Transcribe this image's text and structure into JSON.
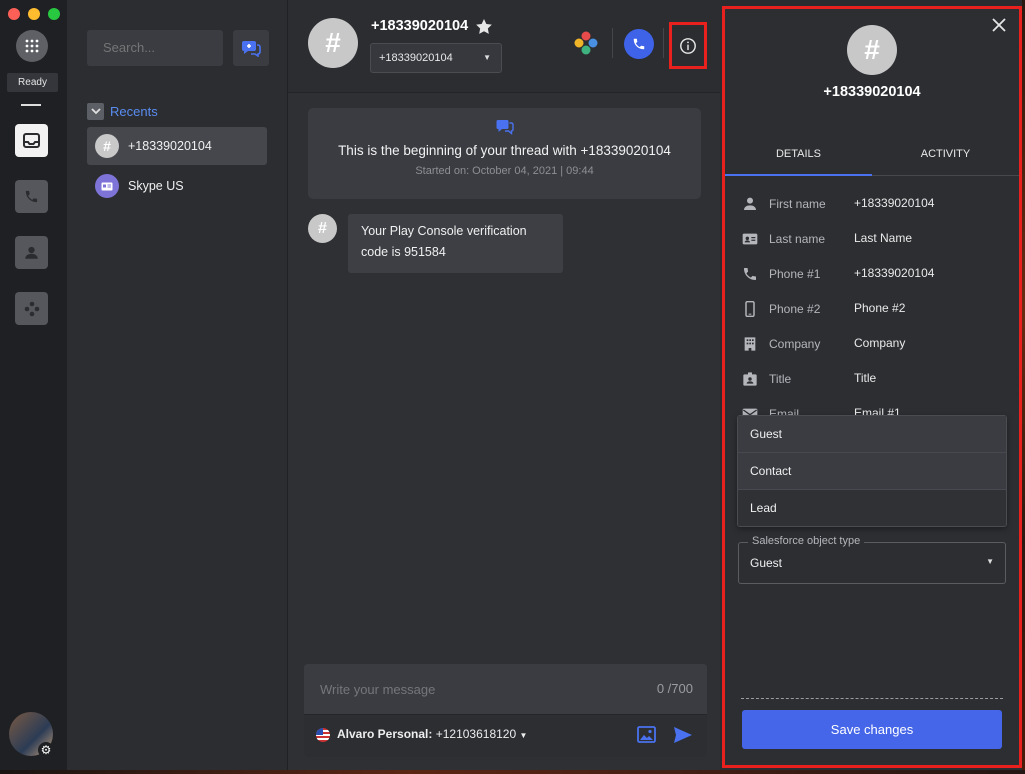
{
  "colors": {
    "accent": "#4566e8",
    "highlight_box": "#e8201e",
    "link": "#5a8cf0",
    "traffic_red": "#fe5f57",
    "traffic_yellow": "#febc2e",
    "traffic_green": "#28c840"
  },
  "rail": {
    "status": "Ready",
    "items": [
      {
        "icon": "inbox-icon",
        "active": true
      },
      {
        "icon": "phone-icon",
        "active": false
      },
      {
        "icon": "contact-icon",
        "active": false
      },
      {
        "icon": "apps-icon",
        "active": false
      }
    ]
  },
  "list": {
    "search_placeholder": "Search...",
    "recents_label": "Recents",
    "contacts": [
      {
        "name": "+18339020104",
        "avatar": "#",
        "selected": true
      },
      {
        "name": "Skype US",
        "avatar": "skype-card-icon",
        "selected": false
      }
    ]
  },
  "thread": {
    "title": "+18339020104",
    "avatar_glyph": "#",
    "number_selected": "+18339020104",
    "begin_text": "This is the beginning of your thread with +18339020104",
    "started_on": "Started on: October 04, 2021 | 09:44",
    "messages": [
      {
        "line1": "Your Play Console verification",
        "line2": "code is 951584"
      }
    ],
    "composer_placeholder": "Write your message",
    "counter": "0 /700",
    "from_name": "Alvaro Personal:",
    "from_number": "+12103618120"
  },
  "panel": {
    "avatar_glyph": "#",
    "name": "+18339020104",
    "tabs": [
      "DETAILS",
      "ACTIVITY"
    ],
    "fields": [
      {
        "label": "First name",
        "value": "+18339020104",
        "icon": "person-icon"
      },
      {
        "label": "Last name",
        "value": "Last Name",
        "icon": "id-card-icon"
      },
      {
        "label": "Phone #1",
        "value": "+18339020104",
        "icon": "phone-icon"
      },
      {
        "label": "Phone #2",
        "value": "Phone #2",
        "icon": "mobile-icon"
      },
      {
        "label": "Company",
        "value": "Company",
        "icon": "building-icon"
      },
      {
        "label": "Title",
        "value": "Title",
        "icon": "badge-icon"
      },
      {
        "label": "Email",
        "value": "Email #1",
        "icon": "mail-icon"
      }
    ],
    "dropdown_options": [
      "Guest",
      "Contact",
      "Lead"
    ],
    "sf_label": "Salesforce object type",
    "sf_value": "Guest",
    "save_label": "Save changes"
  }
}
